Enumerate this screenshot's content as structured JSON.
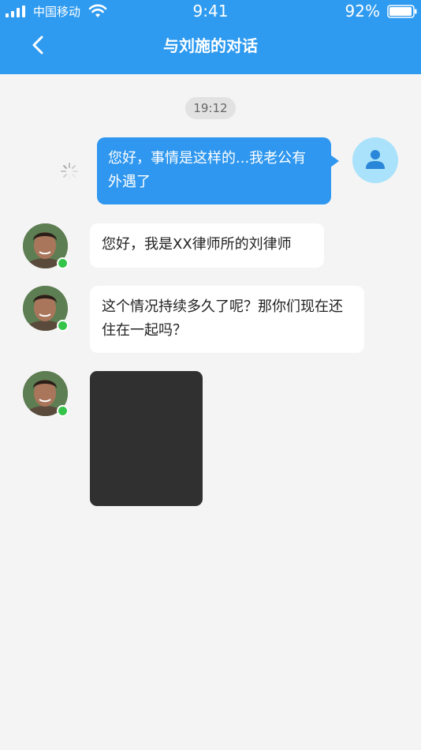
{
  "status_bar": {
    "carrier": "中国移动",
    "time": "9:41",
    "battery": "92%"
  },
  "nav": {
    "title": "与刘施的对话"
  },
  "chat": {
    "timestamp": "19:12",
    "outgoing": {
      "text": "您好，事情是这样的...我老公有外遇了"
    },
    "incoming": [
      {
        "text": "您好，我是XX律师所的刘律师"
      },
      {
        "text": "这个情况持续多久了呢？那你们现在还住在一起吗？"
      }
    ]
  },
  "colors": {
    "header": "#2f9bf0",
    "outgoing_bubble": "#2f97ef",
    "online": "#35c44a",
    "media": "#303030"
  }
}
